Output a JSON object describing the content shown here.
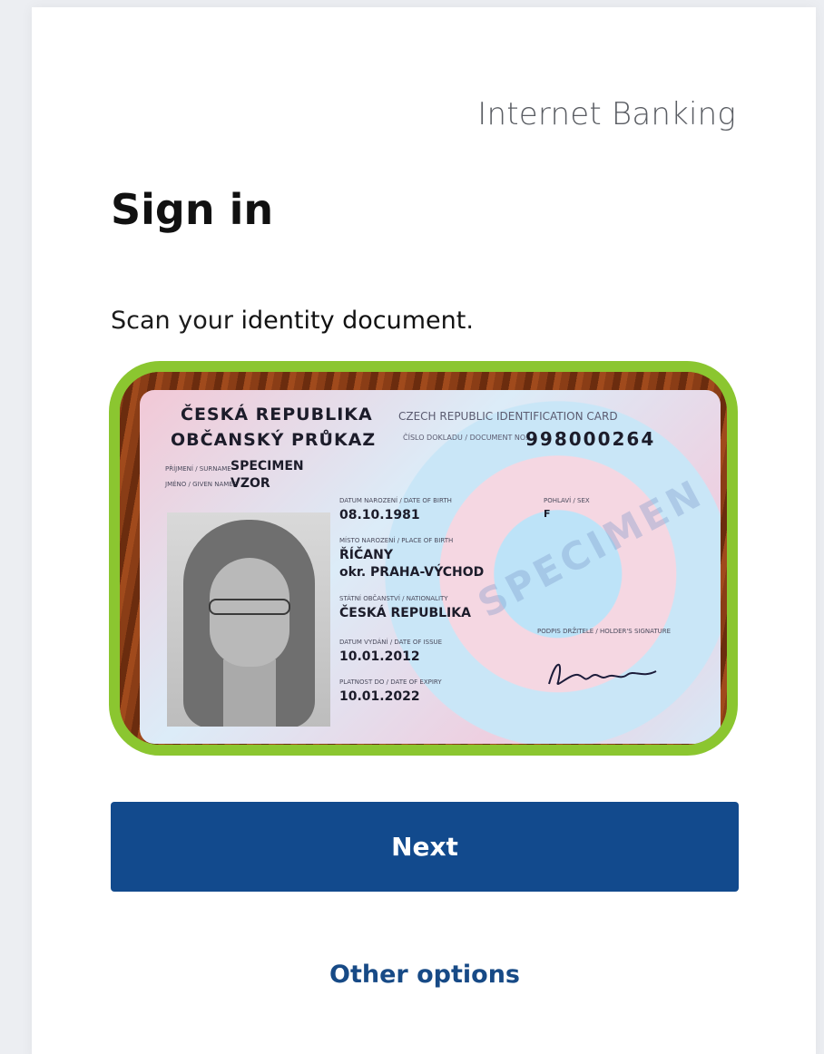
{
  "header": {
    "brand": "Internet Banking"
  },
  "main": {
    "title": "Sign in",
    "instruction_prefix": "Scan your ",
    "instruction_emphasis": "identity document",
    "instruction_suffix": ".",
    "next_label": "Next",
    "other_options_label": "Other options"
  },
  "id_card": {
    "country_cz": "ČESKÁ REPUBLIKA",
    "doc_type_cz": "OBČANSKÝ PRŮKAZ",
    "country_en": "CZECH REPUBLIC  IDENTIFICATION CARD",
    "doc_no_label": "ČÍSLO DOKLADU / DOCUMENT NO.",
    "doc_no": "998000264",
    "surname_label": "PŘÍJMENÍ / SURNAME",
    "surname": "SPECIMEN",
    "given_label": "JMÉNO / GIVEN NAMES",
    "given": "VZOR",
    "dob_label": "DATUM NAROZENÍ / DATE OF BIRTH",
    "dob": "08.10.1981",
    "sex_label": "POHLAVÍ / SEX",
    "sex": "F",
    "pob_label": "MÍSTO NAROZENÍ / PLACE OF BIRTH",
    "pob_line1": "ŘÍČANY",
    "pob_line2": "okr. PRAHA-VÝCHOD",
    "nat_label": "STÁTNÍ OBČANSTVÍ / NATIONALITY",
    "nationality": "ČESKÁ REPUBLIKA",
    "sig_label": "PODPIS DRŽITELE / HOLDER'S SIGNATURE",
    "issue_label": "DATUM VYDÁNÍ / DATE OF ISSUE",
    "issue_date": "10.01.2012",
    "expiry_label": "PLATNOST DO / DATE OF EXPIRY",
    "expiry_date": "10.01.2022",
    "watermark": "SPECIMEN"
  },
  "colors": {
    "accent_button": "#124a8d",
    "frame_green": "#8bc630",
    "link": "#174a86"
  }
}
